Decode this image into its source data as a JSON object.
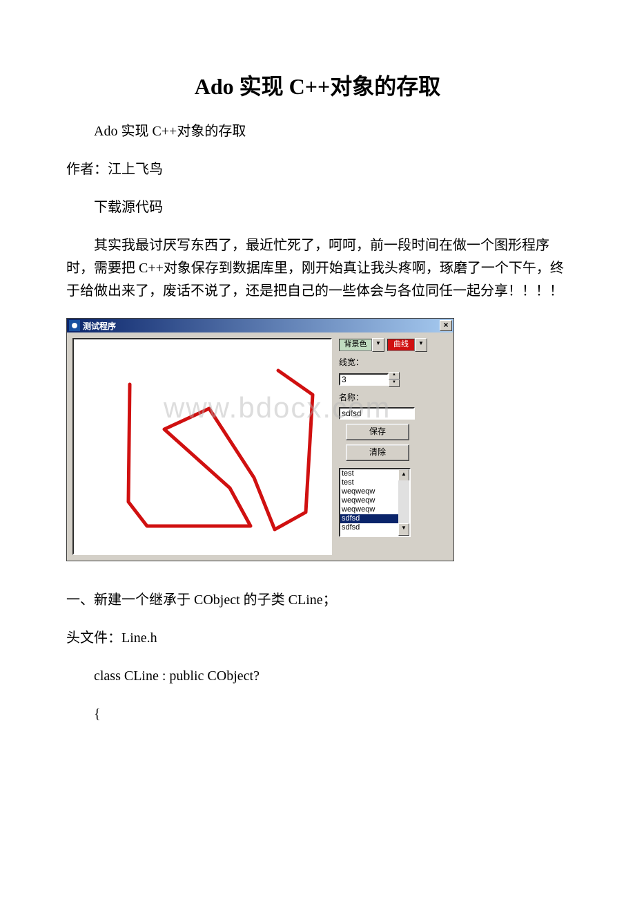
{
  "title": "Ado 实现 C++对象的存取",
  "subtitle": "Ado 实现 C++对象的存取",
  "author_line": "作者：江上飞鸟",
  "download_line": "下载源代码",
  "intro_para": "其实我最讨厌写东西了，最近忙死了，呵呵，前一段时间在做一个图形程序时，需要把 C++对象保存到数据库里，刚开始真让我头疼啊，琢磨了一个下午，终于给做出来了，废话不说了，还是把自己的一些体会与各位同任一起分享！！！！",
  "window": {
    "title": "测试程序",
    "close_glyph": "×",
    "bg_label": "背景色",
    "line_label": "曲线",
    "width_label": "线宽：",
    "width_value": "3",
    "name_label": "名称：",
    "name_value": "sdfsd",
    "save_btn": "保存",
    "clear_btn": "清除",
    "list": [
      "test",
      "test",
      "weqweqw",
      "weqweqw",
      "weqweqw",
      "sdfsd",
      "sdfsd"
    ],
    "selected_index": 5
  },
  "watermark": "www.bdocx.com",
  "section1": "一、新建一个继承于 CObject 的子类 CLine；",
  "header_file": "头文件：Line.h",
  "code1": "class CLine : public CObject?",
  "code2": "{"
}
